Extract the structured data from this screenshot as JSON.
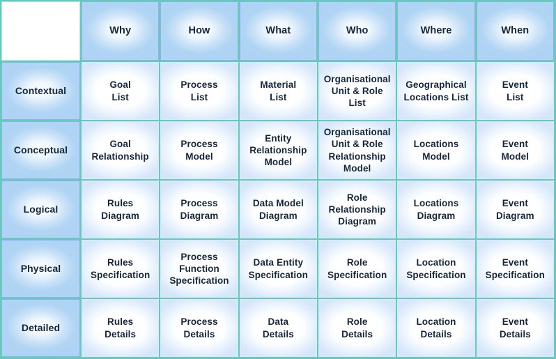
{
  "matrix": {
    "corner_label": "",
    "column_headers": [
      "Why",
      "How",
      "What",
      "Who",
      "Where",
      "When"
    ],
    "row_headers": [
      "Contextual",
      "Conceptual",
      "Logical",
      "Physical",
      "Detailed"
    ],
    "rows": [
      {
        "header": "Contextual",
        "cells": [
          "Goal\nList",
          "Process\nList",
          "Material\nList",
          "Organisational\nUnit & Role\nList",
          "Geographical\nLocations List",
          "Event\nList"
        ]
      },
      {
        "header": "Conceptual",
        "cells": [
          "Goal\nRelationship",
          "Process\nModel",
          "Entity\nRelationship\nModel",
          "Organisational\nUnit & Role\nRelationship\nModel",
          "Locations\nModel",
          "Event\nModel"
        ]
      },
      {
        "header": "Logical",
        "cells": [
          "Rules\nDiagram",
          "Process\nDiagram",
          "Data Model\nDiagram",
          "Role\nRelationship\nDiagram",
          "Locations\nDiagram",
          "Event\nDiagram"
        ]
      },
      {
        "header": "Physical",
        "cells": [
          "Rules\nSpecification",
          "Process\nFunction\nSpecification",
          "Data Entity\nSpecification",
          "Role\nSpecification",
          "Location\nSpecification",
          "Event\nSpecification"
        ]
      },
      {
        "header": "Detailed",
        "cells": [
          "Rules\nDetails",
          "Process\nDetails",
          "Data\nDetails",
          "Role\nDetails",
          "Location\nDetails",
          "Event\nDetails"
        ]
      }
    ]
  },
  "colors": {
    "grid_line": "#66c9bb",
    "header_fill": "#aed3f4",
    "header_border": "#88b6e0",
    "body_fill_edge": "#dceafb",
    "body_border": "#d8eaf6",
    "text": "#14263c",
    "page_background": "#ffffff"
  }
}
